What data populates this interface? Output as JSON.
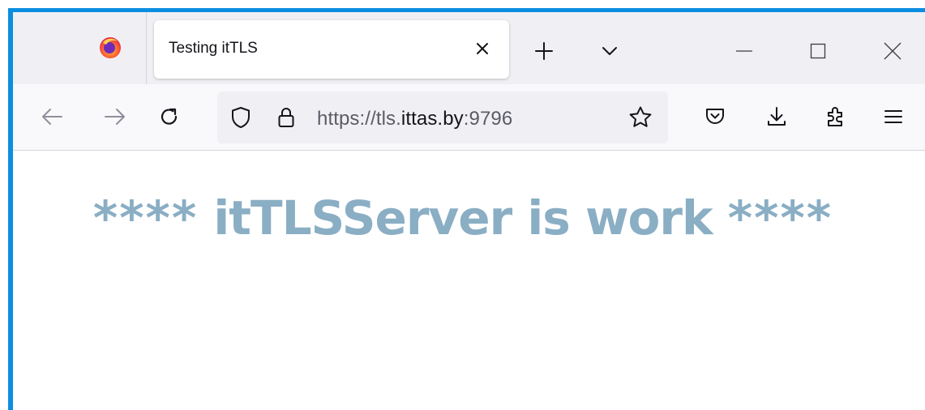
{
  "browser": {
    "tab": {
      "title": "Testing itTLS"
    },
    "url": {
      "prefix": "https://tls.",
      "host": "ittas.by",
      "suffix": ":9796"
    },
    "icons": {
      "logo": "firefox-logo",
      "tab_close": "close-icon",
      "new_tab": "plus-icon",
      "tab_list": "chevron-down-icon",
      "minimize": "minimize-icon",
      "maximize": "maximize-icon",
      "close_window": "close-window-icon",
      "back": "arrow-left-icon",
      "forward": "arrow-right-icon",
      "reload": "reload-icon",
      "tracking_protection": "shield-icon",
      "secure": "lock-icon",
      "bookmark": "star-icon",
      "pocket": "pocket-icon",
      "downloads": "download-icon",
      "extensions": "puzzle-icon",
      "menu": "hamburger-icon"
    },
    "colors": {
      "window_border": "#0c8ee0",
      "tabstrip_bg": "#f0f0f4",
      "navbar_bg": "#f9f9fb",
      "headline": "#8aaec4"
    }
  },
  "page": {
    "headline_left": "****",
    "headline_main": "itTLSServer is work",
    "headline_right": "****"
  }
}
